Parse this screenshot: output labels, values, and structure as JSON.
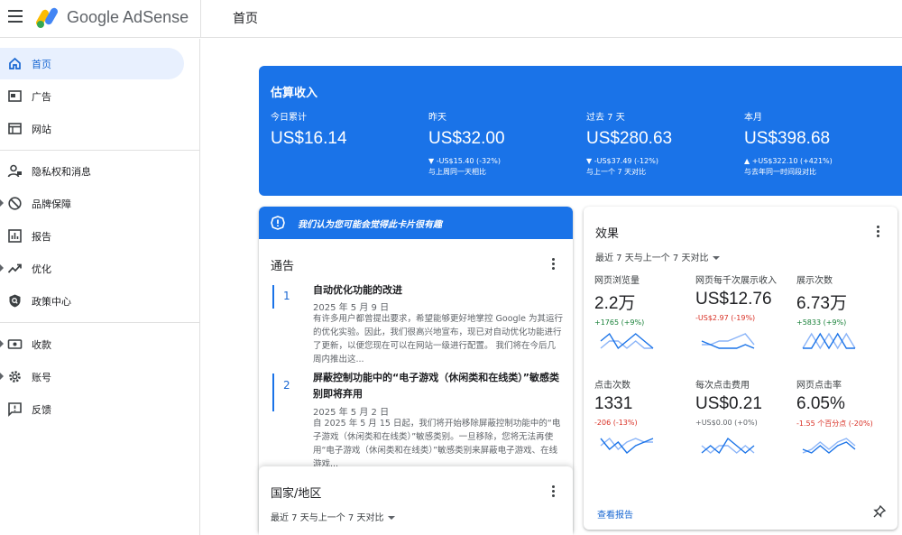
{
  "app": {
    "brand": "Google AdSense",
    "page_title": "首页"
  },
  "sidebar": {
    "items": [
      {
        "label": "首页",
        "icon": "home-icon",
        "active": true
      },
      {
        "label": "广告",
        "icon": "ads-icon"
      },
      {
        "label": "网站",
        "icon": "sites-icon"
      },
      {
        "label": "隐私权和消息",
        "icon": "privacy-icon"
      },
      {
        "label": "品牌保障",
        "icon": "block-icon",
        "expandable": true
      },
      {
        "label": "报告",
        "icon": "reports-icon"
      },
      {
        "label": "优化",
        "icon": "trending-icon",
        "expandable": true
      },
      {
        "label": "政策中心",
        "icon": "policy-icon"
      },
      {
        "label": "收款",
        "icon": "payments-icon",
        "expandable": true
      },
      {
        "label": "账号",
        "icon": "gear-icon",
        "expandable": true
      },
      {
        "label": "反馈",
        "icon": "feedback-icon"
      }
    ]
  },
  "earnings": {
    "title": "估算收入",
    "metrics": [
      {
        "label": "今日累计",
        "value": "US$16.14",
        "change": "",
        "compare": ""
      },
      {
        "label": "昨天",
        "value": "US$32.00",
        "change": "▼ -US$15.40 (-32%)",
        "compare": "与上周同一天相比"
      },
      {
        "label": "过去 7 天",
        "value": "US$280.63",
        "change": "▼ -US$37.49 (-12%)",
        "compare": "与上一个 7 天对比"
      },
      {
        "label": "本月",
        "value": "US$398.68",
        "change": "▲ +US$322.10 (+421%)",
        "compare": "与去年同一时间段对比"
      }
    ]
  },
  "banner": {
    "text": "我们认为您可能会觉得此卡片很有趣"
  },
  "notices": {
    "title": "通告",
    "items": [
      {
        "num": "1",
        "title": "自动优化功能的改进",
        "date": "2025 年 5 月 9 日",
        "body": "有许多用户都曾提出要求，希望能够更好地掌控 Google 为其运行的优化实验。因此，我们很高兴地宣布，现已对自动优化功能进行了更新，以便您现在可以在网站一级进行配置。 我们将在今后几周内推出这..."
      },
      {
        "num": "2",
        "title": "屏蔽控制功能中的“电子游戏（休闲类和在线类）”敏感类别即将弃用",
        "date": "2025 年 5 月 2 日",
        "body": "自 2025 年 5 月 15 日起，我们将开始移除屏蔽控制功能中的“电子游戏（休闲类和在线类）”敏感类别。一旦移除，您将无法再使用“电子游戏（休闲类和在线类）”敏感类别来屏蔽电子游戏、在线游戏..."
      }
    ]
  },
  "country": {
    "title": "国家/地区",
    "period": "最近 7 天与上一个 7 天对比"
  },
  "performance": {
    "title": "效果",
    "period": "最近 7 天与上一个 7 天对比",
    "stats": [
      {
        "label": "网页浏览量",
        "value": "2.2万",
        "change": "+1765 (+9%)",
        "trend": "pos",
        "current": [
          5,
          6,
          4,
          5,
          6,
          5,
          4
        ],
        "previous": [
          4,
          5,
          5,
          4,
          5,
          4,
          4
        ]
      },
      {
        "label": "网页每千次展示收入",
        "value": "US$12.76",
        "change": "-US$2.97 (-19%)",
        "trend": "neg",
        "current": [
          5,
          4,
          3,
          3,
          3,
          4,
          3
        ],
        "previous": [
          4,
          4,
          5,
          5,
          6,
          7,
          4
        ]
      },
      {
        "label": "展示次数",
        "value": "6.73万",
        "change": "+5833 (+9%)",
        "trend": "pos",
        "current": [
          4,
          4,
          5,
          4,
          5,
          4,
          4
        ],
        "previous": [
          4,
          5,
          4,
          5,
          4,
          5,
          4
        ]
      },
      {
        "label": "点击次数",
        "value": "1331",
        "change": "-206 (-13%)",
        "trend": "neg",
        "current": [
          6,
          3,
          5,
          2,
          4,
          5,
          6
        ],
        "previous": [
          4,
          6,
          3,
          5,
          6,
          5,
          5
        ]
      },
      {
        "label": "每次点击费用",
        "value": "US$0.21",
        "change": "+US$0.00 (+0%)",
        "trend": "neu",
        "current": [
          4,
          5,
          4,
          6,
          5,
          4,
          5
        ],
        "previous": [
          5,
          4,
          5,
          5,
          4,
          5,
          4
        ]
      },
      {
        "label": "网页点击率",
        "value": "6.05%",
        "change": "-1.55 个百分点 (-20%)",
        "trend": "neg",
        "current": [
          4,
          3,
          5,
          3,
          5,
          6,
          4
        ],
        "previous": [
          3,
          4,
          6,
          4,
          6,
          7,
          5
        ]
      }
    ],
    "view_report": "查看报告"
  },
  "colors": {
    "primary": "#1a73e8",
    "active_bg": "#e8f0fe",
    "positive": "#188038",
    "negative": "#d93025",
    "spark_current": "#1a73e8",
    "spark_previous": "#8ab4f8"
  }
}
